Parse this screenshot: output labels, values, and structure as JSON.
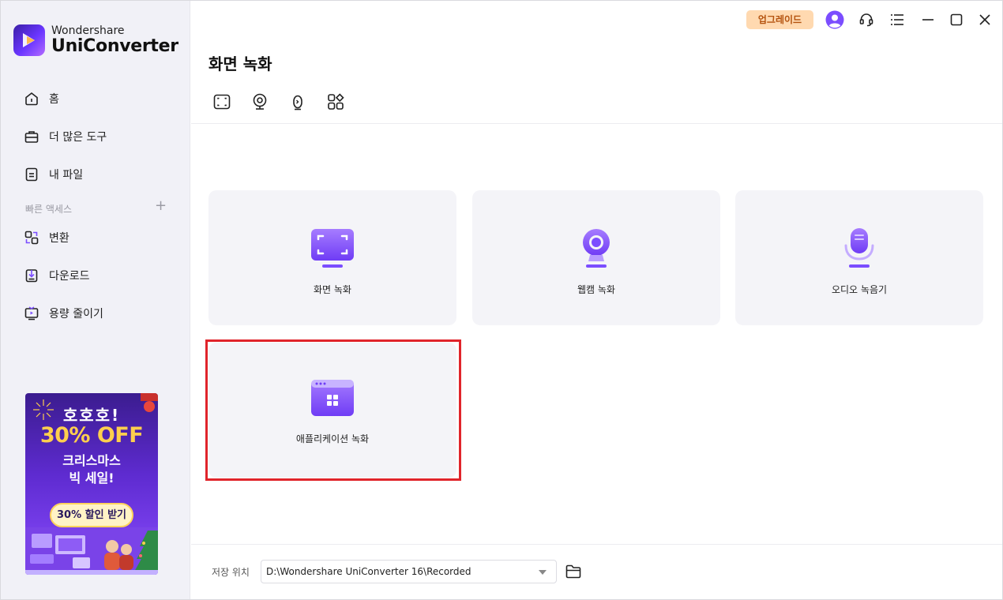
{
  "app": {
    "brand": "Wondershare",
    "product": "UniConverter"
  },
  "sidebar": {
    "items": [
      {
        "label": "홈",
        "icon": "home-icon"
      },
      {
        "label": "더 많은 도구",
        "icon": "toolbox-icon"
      },
      {
        "label": "내 파일",
        "icon": "file-icon"
      }
    ],
    "quick_access_label": "빠른 액세스",
    "quick_access_add": "+",
    "quick_items": [
      {
        "label": "변환",
        "icon": "convert-icon"
      },
      {
        "label": "다운로드",
        "icon": "download-icon"
      },
      {
        "label": "용량 줄이기",
        "icon": "compress-icon"
      }
    ]
  },
  "promo": {
    "line1": "호호호!",
    "line2": "30% OFF",
    "line3": "크리스마스",
    "line4": "빅 세일!",
    "cta": "30% 할인 받기"
  },
  "titlebar": {
    "upgrade_label": "업그레이드",
    "icons": [
      "avatar-icon",
      "headset-icon",
      "menu-icon",
      "minimize-icon",
      "maximize-icon",
      "close-icon"
    ]
  },
  "main": {
    "title": "화면 녹화",
    "mode_icons": [
      "screen-record-mode-icon",
      "webcam-mode-icon",
      "audio-mode-icon",
      "apps-mode-icon"
    ],
    "cards": [
      {
        "label": "화면 녹화",
        "icon": "screen-record-icon"
      },
      {
        "label": "웹캠 녹화",
        "icon": "webcam-icon"
      },
      {
        "label": "오디오 녹음기",
        "icon": "microphone-icon"
      },
      {
        "label": "애플리케이션 녹화",
        "icon": "application-window-icon"
      }
    ]
  },
  "footer": {
    "save_label": "저장 위치",
    "save_path": "D:\\Wondershare UniConverter 16\\Recorded"
  },
  "colors": {
    "accent": "#7b4dff",
    "upgrade_bg": "#ffd9b0",
    "highlight": "#e0242b"
  }
}
